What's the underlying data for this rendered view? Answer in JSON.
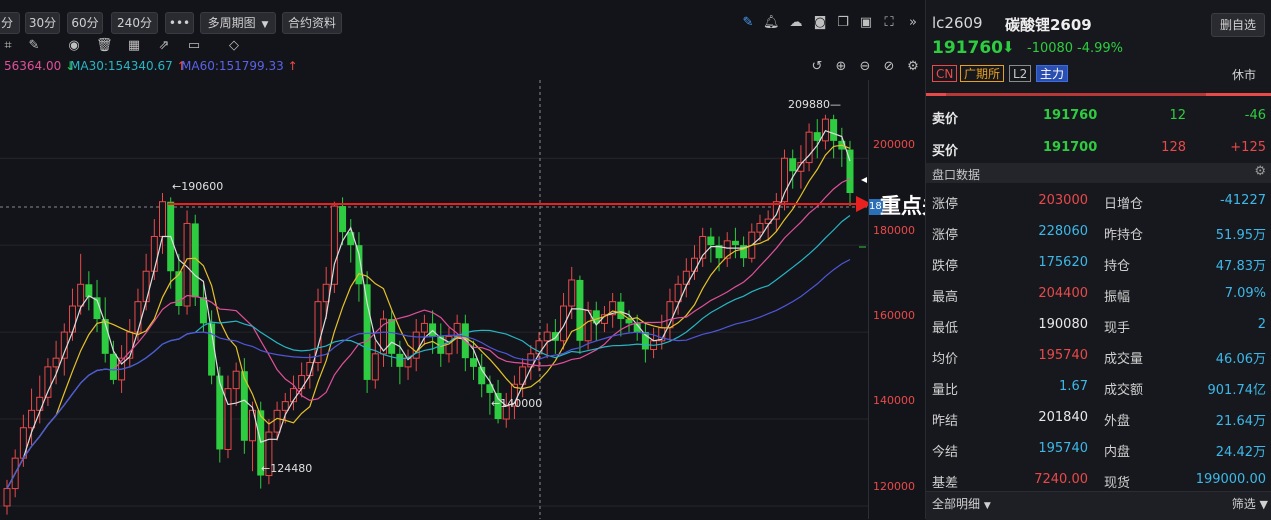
{
  "toolbar": {
    "periods": [
      "分",
      "30分",
      "60分",
      "240分",
      "•••"
    ],
    "multi_period": "多周期图",
    "contract_info": "合约资料"
  },
  "ma_line": {
    "ma_first": "56364.00",
    "ma30": "MA30:154340.67",
    "ma60": "MA60:151799.33"
  },
  "chart_labels": {
    "high_label": "209880",
    "peak_label": "190600",
    "low1_label": "140000",
    "low2_label": "124480",
    "annotation": "重点关注",
    "tag": "18"
  },
  "chart_data": {
    "type": "candlestick",
    "ylim": [
      117000,
      218000
    ],
    "yticks": [
      200000,
      180000,
      160000,
      140000,
      120000
    ],
    "annotations": [
      {
        "text": "209880",
        "value": 209880
      },
      {
        "text": "190600",
        "value": 190600
      },
      {
        "text": "140000",
        "value": 140000
      },
      {
        "text": "124480",
        "value": 124480
      },
      {
        "text": "重点关注",
        "value": 186000
      }
    ],
    "candles": [
      [
        120,
        124,
        118,
        126
      ],
      [
        124,
        131,
        122,
        133
      ],
      [
        131,
        138,
        129,
        141
      ],
      [
        138,
        142,
        134,
        147
      ],
      [
        142,
        145,
        139,
        150
      ],
      [
        145,
        152,
        143,
        154
      ],
      [
        152,
        154,
        148,
        158
      ],
      [
        154,
        160,
        150,
        162
      ],
      [
        160,
        166,
        158,
        170
      ],
      [
        166,
        171,
        164,
        178
      ],
      [
        171,
        168,
        165,
        174
      ],
      [
        168,
        163,
        160,
        172
      ],
      [
        163,
        155,
        153,
        168
      ],
      [
        155,
        149,
        148,
        158
      ],
      [
        149,
        154,
        146,
        157
      ],
      [
        154,
        160,
        152,
        163
      ],
      [
        160,
        167,
        158,
        170
      ],
      [
        167,
        174,
        165,
        178
      ],
      [
        174,
        182,
        172,
        186
      ],
      [
        182,
        190,
        178,
        192
      ],
      [
        190,
        174,
        170,
        191
      ],
      [
        174,
        166,
        164,
        178
      ],
      [
        166,
        185,
        164,
        188
      ],
      [
        185,
        168,
        166,
        187
      ],
      [
        168,
        162,
        160,
        171
      ],
      [
        162,
        150,
        148,
        165
      ],
      [
        150,
        133,
        130,
        152
      ],
      [
        133,
        147,
        131,
        150
      ],
      [
        147,
        151,
        143,
        153
      ],
      [
        151,
        135,
        132,
        154
      ],
      [
        135,
        142,
        128,
        144
      ],
      [
        142,
        127,
        124,
        144
      ],
      [
        127,
        137,
        125,
        140
      ],
      [
        137,
        142,
        135,
        144
      ],
      [
        142,
        144,
        139,
        146
      ],
      [
        144,
        147,
        142,
        150
      ],
      [
        147,
        150,
        145,
        153
      ],
      [
        150,
        153,
        147,
        155
      ],
      [
        153,
        167,
        151,
        170
      ],
      [
        167,
        171,
        163,
        175
      ],
      [
        171,
        189,
        169,
        190
      ],
      [
        189,
        183,
        180,
        191
      ],
      [
        183,
        180,
        176,
        186
      ],
      [
        180,
        171,
        167,
        183
      ],
      [
        171,
        149,
        146,
        174
      ],
      [
        149,
        155,
        147,
        158
      ],
      [
        155,
        163,
        152,
        165
      ],
      [
        163,
        155,
        152,
        165
      ],
      [
        155,
        152,
        148,
        158
      ],
      [
        152,
        154,
        149,
        156
      ],
      [
        154,
        160,
        151,
        163
      ],
      [
        160,
        162,
        157,
        164
      ],
      [
        162,
        159,
        155,
        165
      ],
      [
        159,
        155,
        152,
        162
      ],
      [
        155,
        159,
        153,
        161
      ],
      [
        159,
        162,
        155,
        164
      ],
      [
        162,
        154,
        151,
        164
      ],
      [
        154,
        152,
        149,
        158
      ],
      [
        152,
        148,
        145,
        155
      ],
      [
        148,
        146,
        141,
        150
      ],
      [
        146,
        140,
        139,
        149
      ],
      [
        140,
        143,
        138,
        146
      ],
      [
        143,
        148,
        140,
        150
      ],
      [
        148,
        152,
        145,
        154
      ],
      [
        152,
        155,
        149,
        157
      ],
      [
        155,
        158,
        151,
        160
      ],
      [
        158,
        160,
        154,
        162
      ],
      [
        160,
        158,
        155,
        163
      ],
      [
        158,
        166,
        156,
        169
      ],
      [
        166,
        172,
        163,
        175
      ],
      [
        172,
        158,
        155,
        173
      ],
      [
        158,
        165,
        156,
        167
      ],
      [
        165,
        162,
        158,
        167
      ],
      [
        162,
        164,
        160,
        166
      ],
      [
        164,
        167,
        161,
        169
      ],
      [
        167,
        163,
        159,
        169
      ],
      [
        163,
        162,
        160,
        165
      ],
      [
        162,
        160,
        158,
        164
      ],
      [
        160,
        156,
        153,
        162
      ],
      [
        156,
        158,
        154,
        161
      ],
      [
        158,
        161,
        156,
        164
      ],
      [
        161,
        167,
        158,
        170
      ],
      [
        167,
        171,
        164,
        173
      ],
      [
        171,
        174,
        168,
        177
      ],
      [
        174,
        177,
        172,
        180
      ],
      [
        177,
        182,
        175,
        184
      ],
      [
        182,
        180,
        176,
        184
      ],
      [
        180,
        177,
        174,
        182
      ],
      [
        177,
        181,
        175,
        183
      ],
      [
        181,
        180,
        177,
        184
      ],
      [
        180,
        177,
        175,
        182
      ],
      [
        177,
        183,
        176,
        185
      ],
      [
        183,
        185,
        181,
        187
      ],
      [
        185,
        186,
        181,
        188
      ],
      [
        186,
        190,
        183,
        192
      ],
      [
        190,
        200,
        188,
        202
      ],
      [
        200,
        197,
        193,
        202
      ],
      [
        197,
        199,
        193,
        203
      ],
      [
        199,
        206,
        197,
        208
      ],
      [
        206,
        204,
        200,
        209
      ],
      [
        204,
        209,
        202,
        210
      ],
      [
        209,
        204,
        200,
        210
      ],
      [
        204,
        202,
        198,
        207
      ],
      [
        202,
        192,
        189,
        204
      ]
    ]
  },
  "right_axis": [
    "200000",
    "180000",
    "160000",
    "140000",
    "120000"
  ],
  "instrument": {
    "code": "lc2609",
    "name": "碳酸锂2609",
    "price": "191760",
    "change": "-10080",
    "change_pct": "-4.99%",
    "remove_btn": "删自选",
    "badges": [
      "CN",
      "广期所",
      "L2",
      "主力"
    ],
    "status": "休市"
  },
  "quotes": {
    "ask_label": "卖价",
    "ask_price": "191760",
    "ask_vol": "12",
    "ask_chg": "-46",
    "bid_label": "买价",
    "bid_price": "191700",
    "bid_vol": "128",
    "bid_chg": "+125"
  },
  "panel_title": "盘口数据",
  "stats": [
    {
      "l1": "涨停",
      "v1": "203000",
      "l2": "日增仓",
      "v2": "-41227"
    },
    {
      "l1": "涨停",
      "v1": "228060",
      "l2": "昨持仓",
      "v2": "51.95万"
    },
    {
      "l1": "跌停",
      "v1": "175620",
      "l2": "持仓",
      "v2": "47.83万"
    },
    {
      "l1": "最高",
      "v1": "204400",
      "l2": "振幅",
      "v2": "7.09%"
    },
    {
      "l1": "最低",
      "v1": "190080",
      "l2": "现手",
      "v2": "2"
    },
    {
      "l1": "均价",
      "v1": "195740",
      "l2": "成交量",
      "v2": "46.06万"
    },
    {
      "l1": "量比",
      "v1": "1.67",
      "l2": "成交额",
      "v2": "901.74亿"
    },
    {
      "l1": "昨结",
      "v1": "201840",
      "l2": "外盘",
      "v2": "21.64万"
    },
    {
      "l1": "今结",
      "v1": "195740",
      "l2": "内盘",
      "v2": "24.42万"
    },
    {
      "l1": "基差",
      "v1": "7240.00",
      "l2": "现货",
      "v2": "199000.00"
    }
  ],
  "footer": {
    "detail": "全部明细",
    "filter": "筛选"
  },
  "colors": {
    "up": "#e84a4a",
    "down": "#2ecc40",
    "ma_yellow": "#e6c229",
    "ma_pink": "#e0509a",
    "ma_cyan": "#27b5c4",
    "ma_blue": "#4f56d8",
    "ma_white": "#dddddd"
  }
}
